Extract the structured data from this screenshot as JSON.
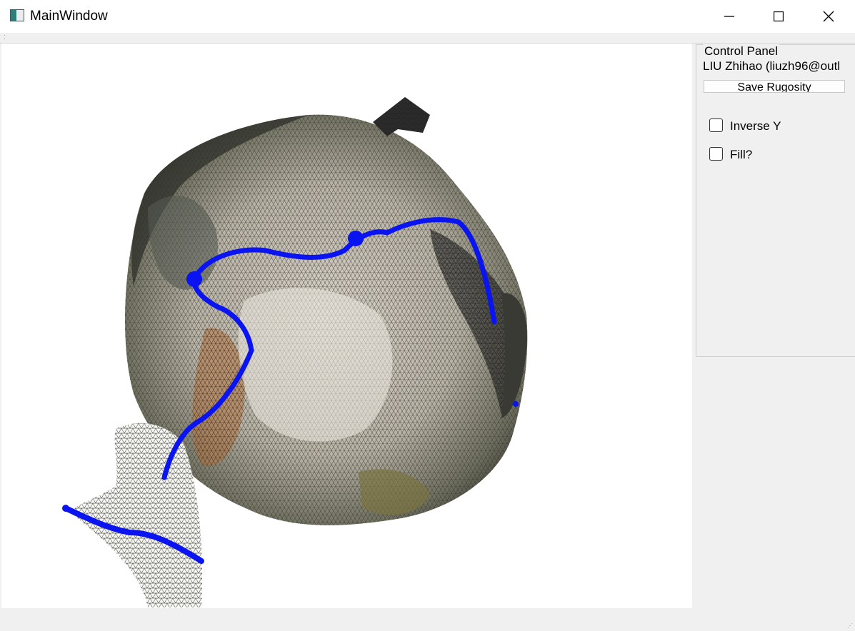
{
  "window": {
    "title": "MainWindow",
    "minimize_icon": "minimize-icon",
    "maximize_icon": "maximize-icon",
    "close_icon": "close-icon"
  },
  "control_panel": {
    "title": "Control Panel",
    "author": "LIU Zhihao (liuzh96@outl",
    "save_button": "Save Rugosity",
    "inverse_y": {
      "label": "Inverse Y",
      "checked": false
    },
    "fill": {
      "label": "Fill?",
      "checked": false
    }
  },
  "viewport": {
    "content": "3d-mesh-view",
    "profile_line_color": "#0a14f0"
  }
}
